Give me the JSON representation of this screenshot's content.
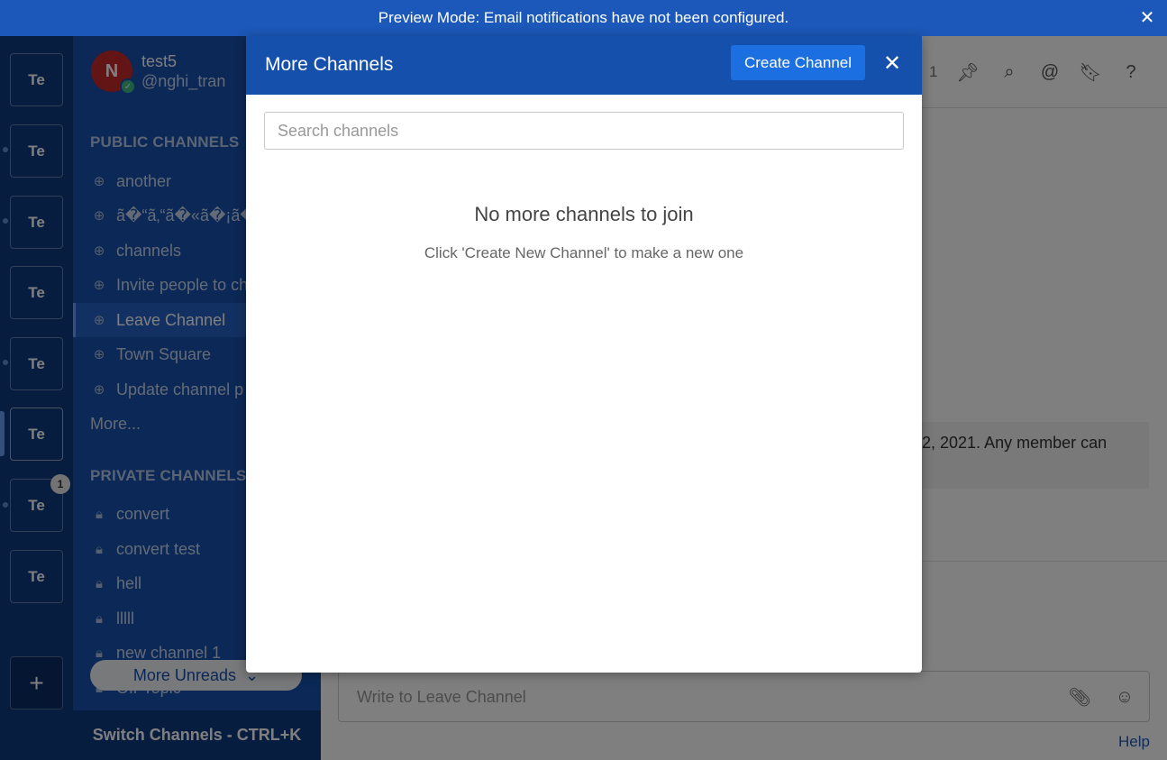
{
  "banner": {
    "message": "Preview Mode: Email notifications have not been configured.",
    "close_glyph": "✕"
  },
  "teams": {
    "label": "Te",
    "items": [
      {
        "label": "Te",
        "unread_dot": false
      },
      {
        "label": "Te",
        "unread_dot": true
      },
      {
        "label": "Te",
        "unread_dot": true
      },
      {
        "label": "Te",
        "unread_dot": true
      },
      {
        "label": "Te",
        "unread_dot": true
      },
      {
        "label": "Te",
        "active": true
      },
      {
        "label": "Te",
        "unread_dot": true,
        "badge": "1"
      },
      {
        "label": "Te",
        "unread_dot": false
      }
    ],
    "add_glyph": "+"
  },
  "profile": {
    "initial": "N",
    "name": "test5",
    "handle": "@nghi_tran"
  },
  "sidebar": {
    "public_title": "PUBLIC CHANNELS",
    "public_channels": [
      {
        "label": "another"
      },
      {
        "label": "ã�“ã‚“ã�«ã�¡ã�"
      },
      {
        "label": "channels"
      },
      {
        "label": "Invite people to ch"
      },
      {
        "label": "Leave Channel",
        "active": true
      },
      {
        "label": "Town Square"
      },
      {
        "label": "Update channel p"
      }
    ],
    "more_label": "More...",
    "private_title": "PRIVATE CHANNELS",
    "private_channels": [
      {
        "label": "convert"
      },
      {
        "label": "convert test"
      },
      {
        "label": "hell"
      },
      {
        "label": "lllll"
      },
      {
        "label": "new channel 1"
      },
      {
        "label": "Off-Topic"
      }
    ],
    "more_unreads_label": "More Unreads",
    "switch_channels_label": "Switch Channels - CTRL+K"
  },
  "main": {
    "header_count": "1",
    "intro_text": "2, 2021. Any member can",
    "input_placeholder": "Write to Leave Channel",
    "help_label": "Help"
  },
  "modal": {
    "title": "More Channels",
    "create_button": "Create Channel",
    "close_glyph": "✕",
    "search_placeholder": "Search channels",
    "search_value": "",
    "empty_title": "No more channels to join",
    "empty_subtitle": "Click 'Create New Channel' to make a new one"
  },
  "colors": {
    "brand": "#1650ad",
    "banner": "#1c58b9",
    "team_sidebar": "#0f3a80",
    "button": "#1c6fe0",
    "online": "#3db887"
  }
}
